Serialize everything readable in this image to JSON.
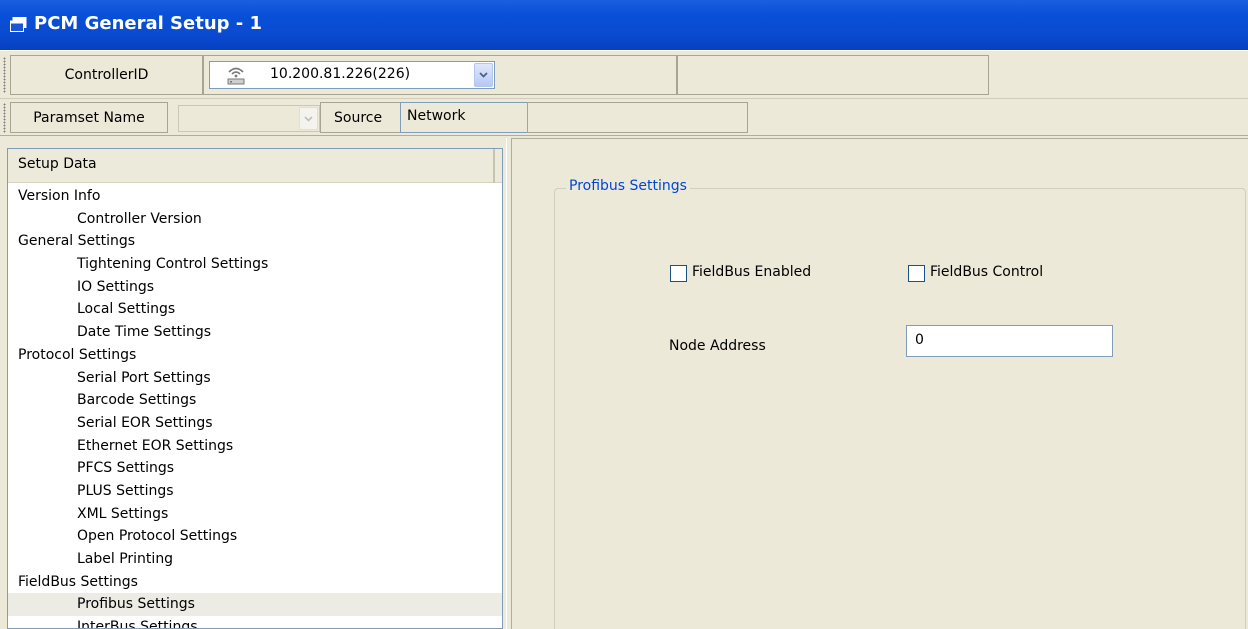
{
  "window": {
    "title": "PCM General Setup - 1"
  },
  "toolbar": {
    "controller_label": "ControllerID",
    "controller_value": "10.200.81.226(226)",
    "paramset_label": "Paramset Name",
    "paramset_value": "",
    "source_label": "Source",
    "source_value": "Network"
  },
  "tree": {
    "header": "Setup Data",
    "items": [
      {
        "label": "Version Info",
        "level": 0
      },
      {
        "label": "Controller Version",
        "level": 1
      },
      {
        "label": "General Settings",
        "level": 0
      },
      {
        "label": "Tightening Control Settings",
        "level": 1
      },
      {
        "label": "IO Settings",
        "level": 1
      },
      {
        "label": "Local Settings",
        "level": 1
      },
      {
        "label": "Date Time Settings",
        "level": 1
      },
      {
        "label": "Protocol Settings",
        "level": 0
      },
      {
        "label": "Serial Port Settings",
        "level": 1
      },
      {
        "label": "Barcode Settings",
        "level": 1
      },
      {
        "label": "Serial EOR Settings",
        "level": 1
      },
      {
        "label": "Ethernet EOR Settings",
        "level": 1
      },
      {
        "label": "PFCS Settings",
        "level": 1
      },
      {
        "label": "PLUS Settings",
        "level": 1
      },
      {
        "label": "XML Settings",
        "level": 1
      },
      {
        "label": "Open Protocol Settings",
        "level": 1
      },
      {
        "label": "Label Printing",
        "level": 1
      },
      {
        "label": "FieldBus Settings",
        "level": 0
      },
      {
        "label": "Profibus Settings",
        "level": 1,
        "selected": true
      },
      {
        "label": "InterBus Settings",
        "level": 1
      }
    ]
  },
  "profibus": {
    "group_title": "Profibus Settings",
    "fieldbus_enabled_label": "FieldBus Enabled",
    "fieldbus_enabled_checked": false,
    "fieldbus_control_label": "FieldBus Control",
    "fieldbus_control_checked": false,
    "node_address_label": "Node Address",
    "node_address_value": "0"
  },
  "colors": {
    "titlebar": "#0a4ad0",
    "group_title": "#0046d5",
    "background": "#ece9d8"
  }
}
